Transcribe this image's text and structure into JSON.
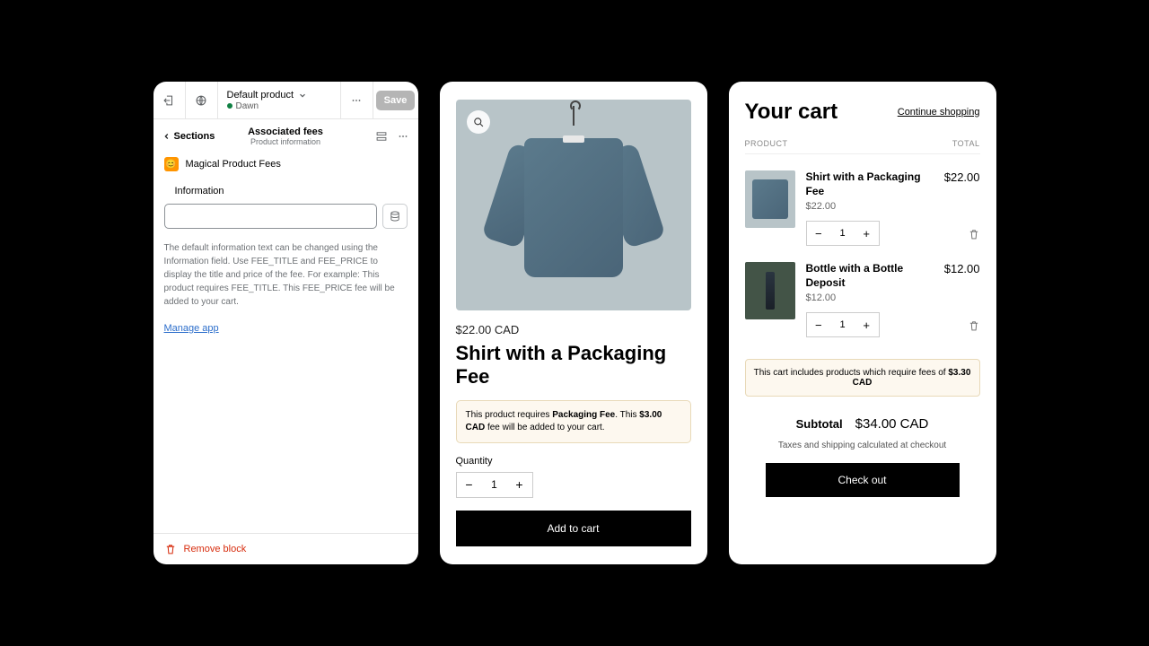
{
  "editor": {
    "product_label": "Default product",
    "theme_name": "Dawn",
    "save_label": "Save",
    "sections_label": "Sections",
    "block_title": "Associated fees",
    "block_subtitle": "Product information",
    "app_name": "Magical Product Fees",
    "info_heading": "Information",
    "help_text": "The default information text can be changed using the Information field. Use FEE_TITLE and FEE_PRICE to display the title and price of the fee. For example: This product requires FEE_TITLE. This FEE_PRICE fee will be added to your cart.",
    "manage_app": "Manage app",
    "remove_block": "Remove block"
  },
  "product": {
    "price": "$22.00 CAD",
    "title": "Shirt with a Packaging Fee",
    "fee_prefix": "This product requires ",
    "fee_name": "Packaging Fee",
    "fee_mid": ". This ",
    "fee_price": "$3.00 CAD",
    "fee_suffix": " fee will be added to your cart.",
    "qty_label": "Quantity",
    "qty_value": "1",
    "add_to_cart": "Add to cart"
  },
  "cart": {
    "heading": "Your cart",
    "continue": "Continue shopping",
    "col_product": "PRODUCT",
    "col_total": "TOTAL",
    "items": [
      {
        "name": "Shirt with a Packaging Fee",
        "price": "$22.00",
        "qty": "1",
        "total": "$22.00"
      },
      {
        "name": "Bottle with a Bottle Deposit",
        "price": "$12.00",
        "qty": "1",
        "total": "$12.00"
      }
    ],
    "fee_note_prefix": "This cart includes products which require fees of ",
    "fee_note_amount": "$3.30 CAD",
    "subtotal_label": "Subtotal",
    "subtotal_value": "$34.00 CAD",
    "tax_note": "Taxes and shipping calculated at checkout",
    "checkout": "Check out"
  }
}
